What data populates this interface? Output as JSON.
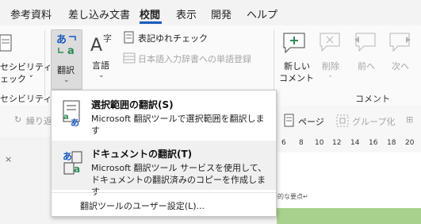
{
  "tabs": [
    {
      "label": "参考資料"
    },
    {
      "label": "差し込み文書"
    },
    {
      "label": "校閲",
      "active": true
    },
    {
      "label": "表示"
    },
    {
      "label": "開発"
    },
    {
      "label": "ヘルプ"
    }
  ],
  "ribbon": {
    "accessibility_label_1": "セシビリティ",
    "accessibility_label_2": "ェック ˅",
    "accessibility_group": "セシビリティ",
    "translate_label": "翻訳",
    "language_label": "言語",
    "proofing_check": "表記ゆれチェック",
    "japanese_dictionary": "日本語入力辞書への単語登録",
    "new_comment_1": "新しい",
    "new_comment_2": "コメント",
    "delete_label": "削除",
    "prev_label": "前へ",
    "next_label": "次へ",
    "comments_group": "コメント"
  },
  "toolbar2": {
    "repeat_label": "繰り返",
    "page_label": "ページ",
    "group_label": "グループ化"
  },
  "ruler": [
    "6",
    "8",
    "10",
    "12",
    "14",
    "16",
    "18",
    "20"
  ],
  "doc_text": "断的な要点↵",
  "menu": {
    "item1_title": "選択範囲の翻訳(S)",
    "item1_desc": "Microsoft 翻訳ツールで選択範囲を翻訳します",
    "item2_title": "ドキュメントの翻訳(T)",
    "item2_desc": "Microsoft 翻訳ツール サービスを使用して、ドキュメントの翻訳済みのコピーを作成します",
    "footer": "翻訳ツールのユーザー設定(L)..."
  },
  "colors": {
    "accent": "#185abd",
    "green": "#a9d18e",
    "translate_green": "#2e8b57"
  }
}
